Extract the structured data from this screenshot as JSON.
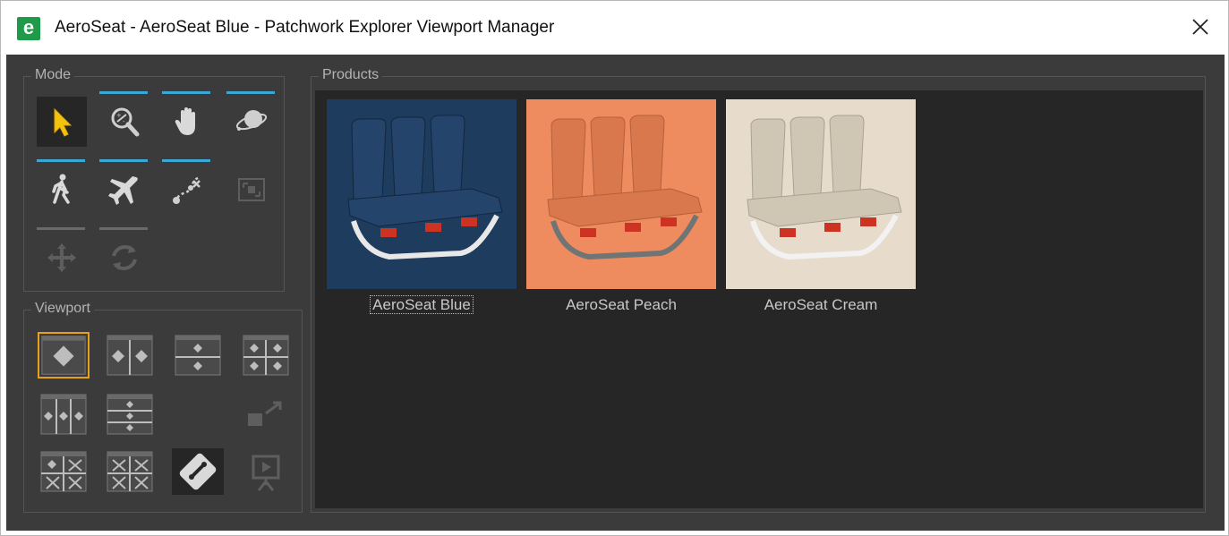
{
  "window": {
    "title": "AeroSeat - AeroSeat Blue - Patchwork Explorer Viewport Manager",
    "app_icon_glyph": "e"
  },
  "mode": {
    "label": "Mode",
    "tools": [
      {
        "name": "select",
        "icon": "arrow-cursor-icon",
        "selected": true
      },
      {
        "name": "zoom",
        "icon": "magnifier-zoom-icon"
      },
      {
        "name": "pan",
        "icon": "hand-icon"
      },
      {
        "name": "orbit",
        "icon": "orbit-icon"
      },
      {
        "name": "walk",
        "icon": "walk-icon"
      },
      {
        "name": "fly",
        "icon": "airplane-icon"
      },
      {
        "name": "path",
        "icon": "path-icon"
      },
      {
        "name": "frame",
        "icon": "frame-icon"
      },
      {
        "name": "move",
        "icon": "move-arrows-icon"
      },
      {
        "name": "rotate",
        "icon": "rotate-icon"
      }
    ]
  },
  "viewport": {
    "label": "Viewport",
    "layouts": [
      {
        "name": "single"
      },
      {
        "name": "two-vertical"
      },
      {
        "name": "two-horizontal"
      },
      {
        "name": "four"
      },
      {
        "name": "three-vertical"
      },
      {
        "name": "three-horizontal"
      },
      {
        "name": "undock"
      },
      {
        "name": "split-mixed-a"
      },
      {
        "name": "split-mixed-b"
      },
      {
        "name": "settings"
      },
      {
        "name": "presentation"
      }
    ]
  },
  "products": {
    "label": "Products",
    "items": [
      {
        "label": "AeroSeat Blue",
        "bg": "#1d3c5e",
        "seat": "#24446b",
        "accent": "#cc3322"
      },
      {
        "label": "AeroSeat Peach",
        "bg": "#ee8b5f",
        "seat": "#d9784c",
        "accent": "#cc3322"
      },
      {
        "label": "AeroSeat Cream",
        "bg": "#e7dccb",
        "seat": "#cfc6b4",
        "accent": "#cc3322"
      }
    ]
  },
  "colors": {
    "active_tab": "#3ba7d6",
    "highlight": "#e6a118",
    "background": "#3b3b3b"
  }
}
